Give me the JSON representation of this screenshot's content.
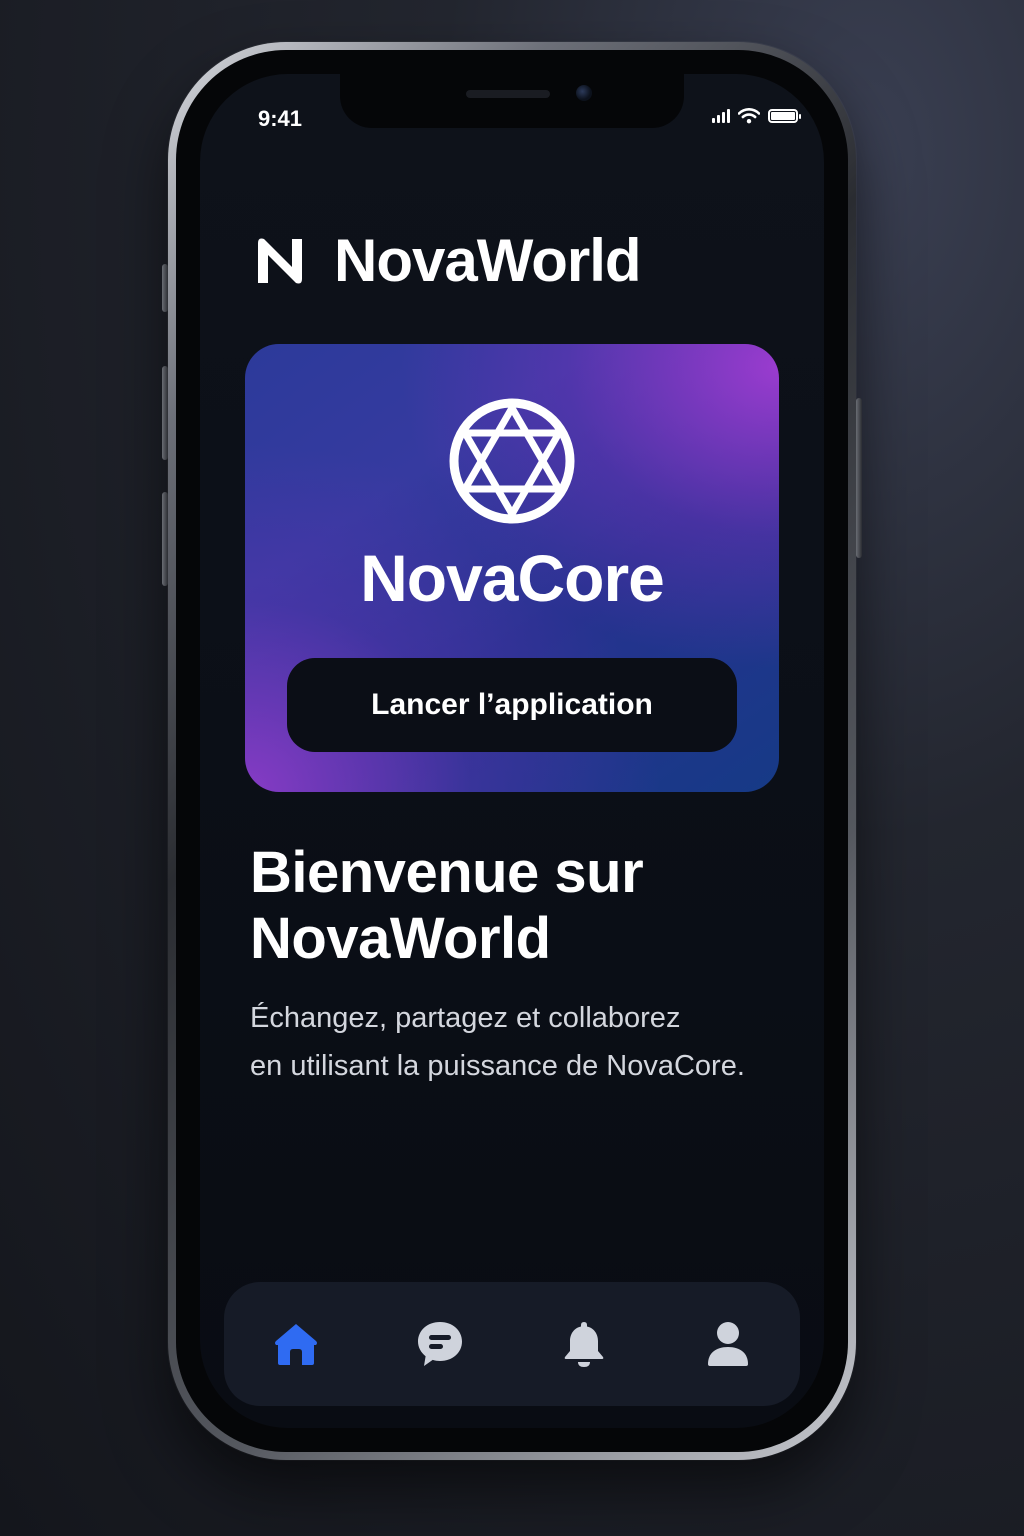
{
  "status_bar": {
    "time": "9:41",
    "battery_level": 1.0
  },
  "header": {
    "app_name": "NovaWorld",
    "logo_icon": "n-logo-icon"
  },
  "hero": {
    "title": "NovaCore",
    "logo_icon": "star-network-icon",
    "button_label": "Lancer l’application"
  },
  "welcome": {
    "title_line1": "Bienvenue sur",
    "title_line2": "NovaWorld",
    "text_line1": "Échangez, partagez et collaborez",
    "text_line2": "en utilisant la puissance de NovaCore."
  },
  "tabbar": {
    "items": [
      {
        "icon": "home-icon",
        "active": true
      },
      {
        "icon": "chat-icon",
        "active": false
      },
      {
        "icon": "bell-icon",
        "active": false
      },
      {
        "icon": "profile-icon",
        "active": false
      }
    ],
    "active_color": "#2f6bf2",
    "inactive_color": "#cfd3dc"
  },
  "colors": {
    "background": "#0b0f17",
    "card_button": "#0b0e16",
    "accent_purple": "#9a3fd0",
    "accent_blue": "#2c3a9a"
  }
}
